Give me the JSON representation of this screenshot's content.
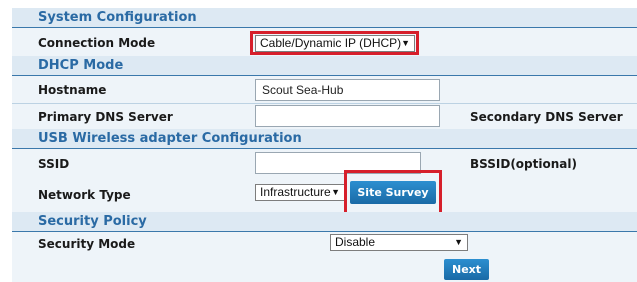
{
  "sections": {
    "system_config": "System Configuration",
    "dhcp_mode": "DHCP Mode",
    "usb_wireless": "USB Wireless adapter Configuration",
    "security_policy": "Security Policy"
  },
  "connection_mode": {
    "label": "Connection Mode",
    "value": "Cable/Dynamic IP (DHCP)"
  },
  "hostname": {
    "label": "Hostname",
    "value": "Scout Sea-Hub"
  },
  "primary_dns": {
    "label": "Primary DNS Server",
    "value": ""
  },
  "secondary_dns": {
    "label": "Secondary DNS Server"
  },
  "ssid": {
    "label": "SSID",
    "value": ""
  },
  "bssid": {
    "label": "BSSID(optional)"
  },
  "network_type": {
    "label": "Network Type",
    "value": "Infrastructure",
    "button": "Site Survey"
  },
  "security_mode": {
    "label": "Security Mode",
    "value": "Disable"
  },
  "next_button": "Next",
  "dropdown_arrow": "▼",
  "colors": {
    "accent": "#2a6aa4",
    "highlight": "#d61f2b",
    "button": "#1f78bb"
  }
}
